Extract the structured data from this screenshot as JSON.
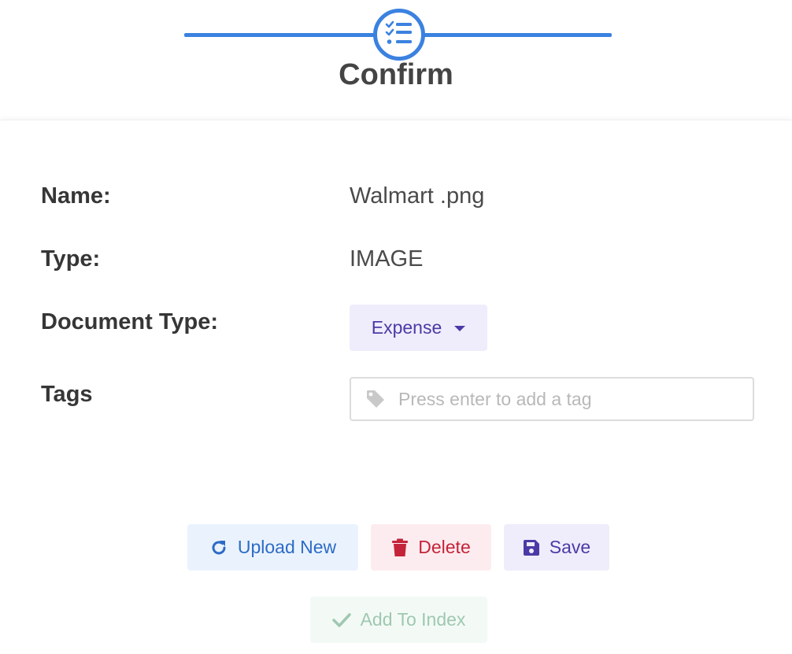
{
  "stepper": {
    "title": "Confirm",
    "icon": "checklist-icon",
    "accent_color": "#3b82e0"
  },
  "fields": {
    "name_label": "Name:",
    "name_value": "Walmart .png",
    "type_label": "Type:",
    "type_value": "IMAGE",
    "doc_type_label": "Document Type:",
    "doc_type_value": "Expense",
    "tags_label": "Tags",
    "tags_placeholder": "Press enter to add a tag",
    "tags_value": ""
  },
  "actions": {
    "upload_new_label": "Upload New",
    "upload_new_icon": "refresh-icon",
    "delete_label": "Delete",
    "delete_icon": "trash-icon",
    "save_label": "Save",
    "save_icon": "floppy-disk-icon",
    "add_to_index_label": "Add To Index",
    "add_to_index_icon": "checkmark-icon"
  },
  "colors": {
    "upload": "#2d6bc6",
    "delete": "#c4243a",
    "save": "#4b3aa6",
    "add_to_index": "#9fc8b0"
  }
}
